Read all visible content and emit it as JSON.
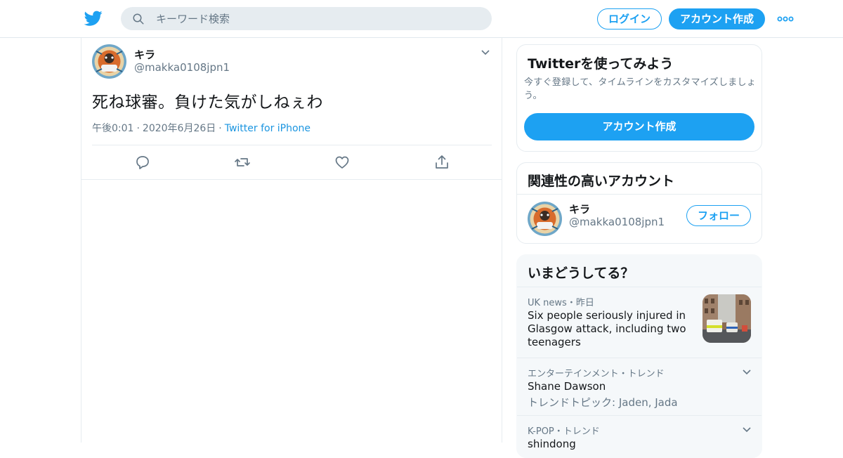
{
  "header": {
    "search_placeholder": "キーワード検索",
    "login_label": "ログイン",
    "signup_label": "アカウント作成",
    "accent_color": "#1da1f2"
  },
  "tweet": {
    "name": "キラ",
    "handle": "@makka0108jpn1",
    "text": "死ね球審。負けた気がしねぇわ",
    "time": "午後0:01",
    "date": "2020年6月26日",
    "source": "Twitter for iPhone",
    "actions": [
      "reply-icon",
      "retweet-icon",
      "like-icon",
      "share-icon"
    ]
  },
  "signup_card": {
    "title": "Twitterを使ってみよう",
    "description": "今すぐ登録して、タイムラインをカスタマイズしましょう。",
    "button_label": "アカウント作成"
  },
  "related_card": {
    "title": "関連性の高いアカウント",
    "account": {
      "name": "キラ",
      "handle": "@makka0108jpn1",
      "follow_label": "フォロー"
    }
  },
  "trends_card": {
    "title": "いまどうしてる？",
    "items": [
      {
        "meta": "UK news・昨日",
        "title": "Six people seriously injured in Glasgow attack, including two teenagers"
      },
      {
        "meta": "エンターテインメント・トレンド",
        "title": "Shane Dawson",
        "sub": "トレンドトピック: Jaden, Jada"
      },
      {
        "meta": "K-POP・トレンド",
        "title": "shindong"
      }
    ]
  }
}
